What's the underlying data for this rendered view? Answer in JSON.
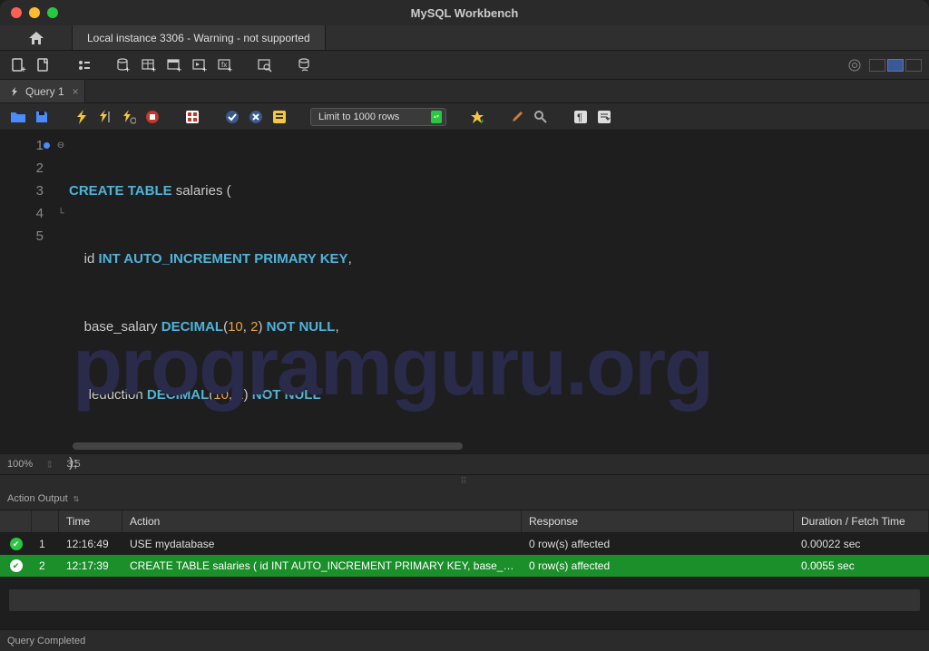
{
  "title": "MySQL Workbench",
  "connection_tab": "Local instance 3306 - Warning - not supported",
  "query_tab": "Query 1",
  "limit_label": "Limit to 1000 rows",
  "editor": {
    "lines": [
      {
        "n": "1",
        "dot": true,
        "fold": "⊖"
      },
      {
        "n": "2"
      },
      {
        "n": "3"
      },
      {
        "n": "4",
        "fold": "└"
      },
      {
        "n": "5"
      }
    ],
    "code": {
      "l1_kw1": "CREATE",
      "l1_kw2": "TABLE",
      "l1_id": "salaries",
      "l1_p": "(",
      "l2_id": "id",
      "l2_kw": "INT AUTO_INCREMENT PRIMARY KEY",
      "l2_p": ",",
      "l3_id": "base_salary",
      "l3_kw1": "DECIMAL",
      "l3_p1": "(",
      "l3_n1": "10",
      "l3_p2": ",",
      "l3_sp": " ",
      "l3_n2": "2",
      "l3_p3": ")",
      "l3_kw2": "NOT NULL",
      "l3_p4": ",",
      "l4_id": "deduction",
      "l4_kw1": "DECIMAL",
      "l4_p1": "(",
      "l4_n1": "10",
      "l4_p2": ",",
      "l4_sp": " ",
      "l4_n2": "2",
      "l4_p3": ")",
      "l4_kw2": "NOT NULL",
      "l5": ");"
    }
  },
  "watermark": "programguru.org",
  "status": {
    "zoom": "100%",
    "cursor": "3:5"
  },
  "output_label": "Action Output",
  "columns": {
    "time": "Time",
    "action": "Action",
    "response": "Response",
    "duration": "Duration / Fetch Time"
  },
  "rows": [
    {
      "idx": "1",
      "time": "12:16:49",
      "action": "USE mydatabase",
      "response": "0 row(s) affected",
      "duration": "0.00022 sec",
      "selected": false
    },
    {
      "idx": "2",
      "time": "12:17:39",
      "action": "CREATE TABLE salaries (     id INT AUTO_INCREMENT PRIMARY KEY,     base_sal...",
      "response": "0 row(s) affected",
      "duration": "0.0055 sec",
      "selected": true
    }
  ],
  "bottom_status": "Query Completed"
}
